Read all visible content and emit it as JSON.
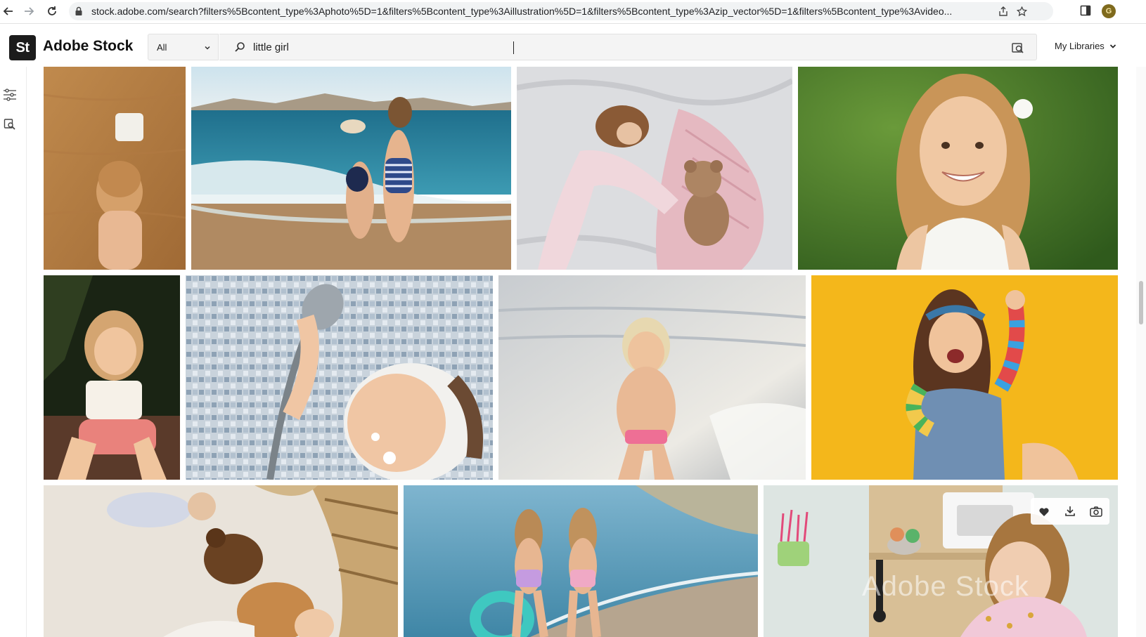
{
  "browser": {
    "url": "stock.adobe.com/search?filters%5Bcontent_type%3Aphoto%5D=1&filters%5Bcontent_type%3Aillustration%5D=1&filters%5Bcontent_type%3Azip_vector%5D=1&filters%5Bcontent_type%3Avideo...",
    "profile_initial": "G",
    "icons": [
      "back-arrow-icon",
      "forward-arrow-icon",
      "reload-icon",
      "lock-icon",
      "share-icon",
      "star-icon",
      "side-panel-icon"
    ]
  },
  "header": {
    "logo_mark": "St",
    "logo_text": "Adobe Stock",
    "filter_selected": "All",
    "search_value": "little girl",
    "my_libraries": "My Libraries"
  },
  "left_rail": {
    "icons": [
      "filter-sliders-icon",
      "visual-search-icon"
    ]
  },
  "results": {
    "watermark": "Adobe Stock",
    "hover_actions": [
      "heart-icon",
      "download-icon",
      "camera-icon"
    ],
    "tiles": [
      {
        "id": "girl-on-wood-floor",
        "row": 1
      },
      {
        "id": "girls-at-beach-waves",
        "row": 1
      },
      {
        "id": "girl-sleeping-with-teddy",
        "row": 1
      },
      {
        "id": "smiling-girl-grass",
        "row": 1
      },
      {
        "id": "girl-sitting-sunlight",
        "row": 2
      },
      {
        "id": "girl-shower-head",
        "row": 2
      },
      {
        "id": "girl-in-sea-foam",
        "row": 2
      },
      {
        "id": "girl-yellow-background",
        "row": 2
      },
      {
        "id": "baby-on-blanket",
        "row": 3
      },
      {
        "id": "girls-walking-shore",
        "row": 3
      },
      {
        "id": "girl-play-kitchen-video",
        "row": 3
      }
    ]
  },
  "colors": {
    "brand_dark": "#1c1c1c",
    "search_bg": "#f4f4f4",
    "accent_yellow": "#f4b71b"
  }
}
